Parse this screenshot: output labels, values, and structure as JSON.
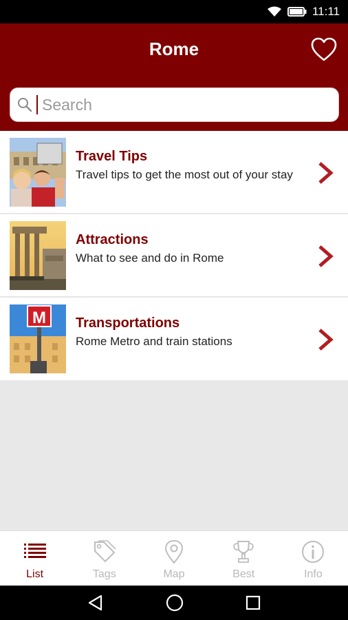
{
  "status": {
    "time": "11:11",
    "icons": [
      "wifi-icon",
      "battery-icon"
    ]
  },
  "header": {
    "title": "Rome",
    "favorite_icon": "heart-outline-icon"
  },
  "search": {
    "placeholder": "Search",
    "icon": "search-icon"
  },
  "list": {
    "items": [
      {
        "title": "Travel Tips",
        "subtitle": "Travel tips to get the most out of your stay",
        "thumbnail": "couple-selfie-colosseum"
      },
      {
        "title": "Attractions",
        "subtitle": "What to see and do in Rome",
        "thumbnail": "roman-forum-columns"
      },
      {
        "title": "Transportations",
        "subtitle": "Rome Metro and train stations",
        "thumbnail": "metro-sign",
        "thumbnail_text": "M"
      }
    ]
  },
  "tabs": [
    {
      "label": "List",
      "icon": "list-icon",
      "active": true
    },
    {
      "label": "Tags",
      "icon": "tag-icon",
      "active": false
    },
    {
      "label": "Map",
      "icon": "map-pin-icon",
      "active": false
    },
    {
      "label": "Best",
      "icon": "trophy-icon",
      "active": false
    },
    {
      "label": "Info",
      "icon": "info-icon",
      "active": false
    }
  ],
  "colors": {
    "brand": "#7f0000",
    "inactive_tab": "#b8b8b8",
    "background": "#e8e8e8"
  }
}
